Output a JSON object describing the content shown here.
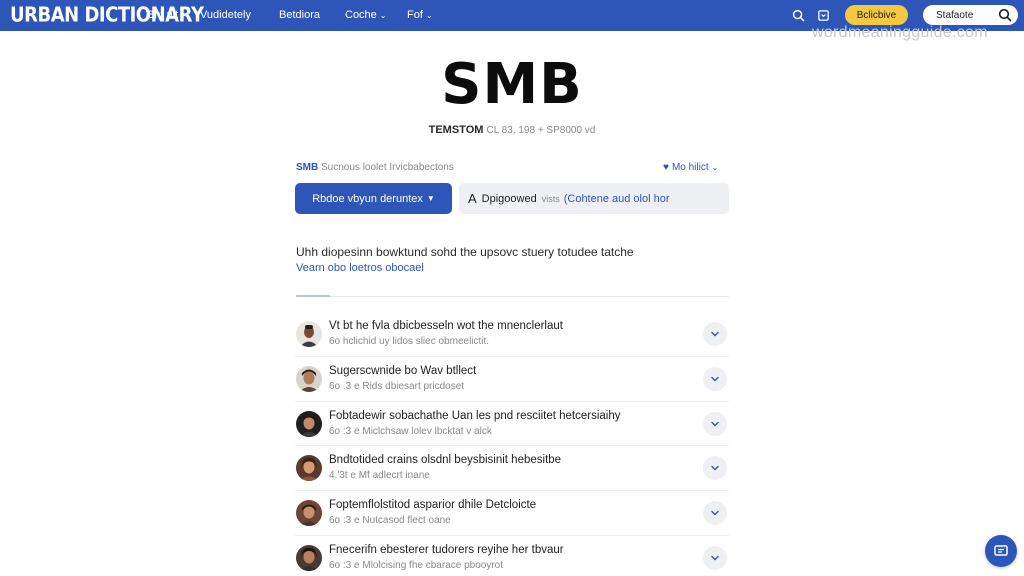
{
  "nav": {
    "logo": "URBAN DICTIONARY",
    "links": [
      {
        "label": "Bnt nit",
        "chevron": false
      },
      {
        "label": "Vudidetely",
        "chevron": false
      },
      {
        "label": "Betdiora",
        "chevron": false
      },
      {
        "label": "Coche",
        "chevron": true
      },
      {
        "label": "Fof",
        "chevron": true
      }
    ],
    "icons": [
      "search-icon",
      "bookmark-icon"
    ],
    "yellow_button": "Bclicbive",
    "search_pill": "Stafaote",
    "colors": {
      "bar": "#2d56b8",
      "accent": "#f5c842"
    }
  },
  "watermark": "wordmeaningguide.com",
  "entry": {
    "word": "SMB",
    "subline_bold": "TEMSTOM",
    "subline_muted": "CL 83, 198 + SP8000 vd",
    "meta_tag": "SMB",
    "meta_desc": "Sucnous loolet Irvicbabectons",
    "meta_right": "Mo hilict",
    "primary_button": "Rbdoe vbyun deruntex",
    "secondary_a": "A",
    "secondary_strong": "Dpigoowed",
    "secondary_muted": "vists",
    "secondary_blue": "(Cohtene aud olol hor",
    "definition": "Uhh diopesinn bowktund sohd the upsovc stuery totudee tatche",
    "example": "Vearn obo loetros obocael"
  },
  "list": [
    {
      "title": "Vt bt he fvla dbicbesseln wot the mnenclerlaut",
      "sub": "6o hclichid uy lidos sliec obmeelictit."
    },
    {
      "title": "Sugerscwnide bo Wav btllect",
      "sub": "6o .3 e Rids dbiesart pricdoset"
    },
    {
      "title": "Fobtadewir sobachathe Uan les pnd resciitet hetcersiaihy",
      "sub": "6o :3 e Miclchsaw lolev lbcktat v alck"
    },
    {
      "title": "Bndtotided crains olsdnl beysbisinit hebesitbe",
      "sub": "4.'3t e Mf adlecrt inane"
    },
    {
      "title": "Foptemflolstitod asparior dhile Detcloicte",
      "sub": "6o :3 e Nutcasod flect oane"
    },
    {
      "title": "Fnecerifn ebesterer tudorers reyihe her tbvaur",
      "sub": "6o :3 e Mlolcising fhe cbarace pbooyrot"
    }
  ],
  "fab_icon": "chat-icon"
}
